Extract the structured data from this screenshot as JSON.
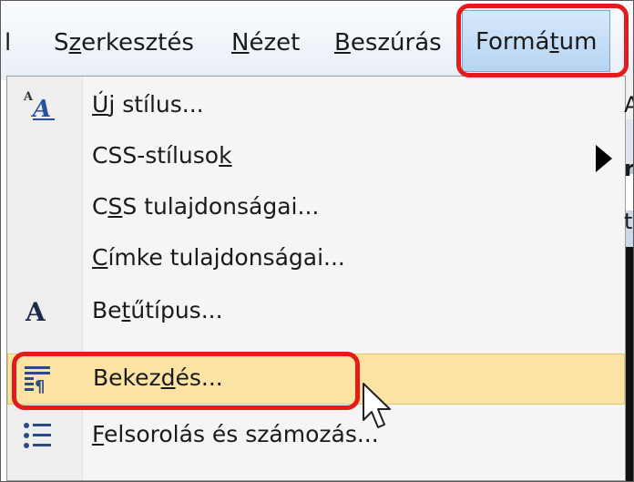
{
  "menubar": {
    "items": [
      {
        "label": "l"
      },
      {
        "pre": "S",
        "u": "z",
        "post": "erkesztés"
      },
      {
        "pre": "",
        "u": "N",
        "post": "ézet"
      },
      {
        "pre": "",
        "u": "B",
        "post": "eszúrás"
      },
      {
        "pre": "Formá",
        "u": "t",
        "post": "um"
      }
    ]
  },
  "menu": {
    "items": [
      {
        "icon": "new-style-icon",
        "pre": "",
        "u": "Ú",
        "post": "j stílus..."
      },
      {
        "icon": "",
        "pre": "CSS-stíluso",
        "u": "k",
        "post": "",
        "submenu": true
      },
      {
        "icon": "",
        "pre": "C",
        "u": "S",
        "post": "S tulajdonságai..."
      },
      {
        "icon": "",
        "pre": "",
        "u": "C",
        "post": "ímke tulajdonságai..."
      },
      {
        "icon": "font-icon",
        "pre": "Be",
        "u": "t",
        "post": "űtípus..."
      },
      {
        "icon": "paragraph-icon",
        "pre": "Bekez",
        "u": "d",
        "post": "és..."
      },
      {
        "icon": "bullets-numbering-icon",
        "pre": "",
        "u": "F",
        "post": "elsorolás és számozás..."
      }
    ]
  },
  "right_edge_chars": [
    "A",
    "r",
    "ta"
  ],
  "colors": {
    "highlight_border": "#e41b1b",
    "hover_fill": "#fbe3a4",
    "active_menu_fill": "#c9def5"
  }
}
